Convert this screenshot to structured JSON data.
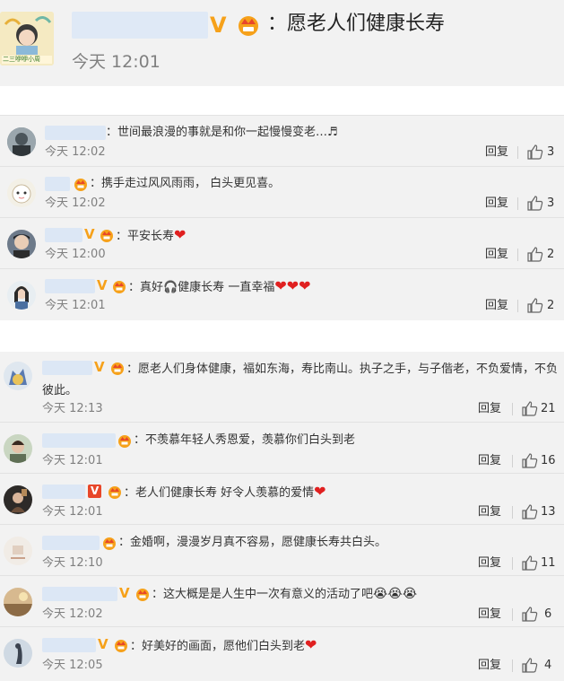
{
  "post": {
    "text": "：愿老人们健康长寿",
    "time": "今天 12:01",
    "avatar_caption": "二三咿咿小周"
  },
  "colors": {
    "vip_gold": "#f6a11a",
    "heart_red": "#e8282a",
    "panel_bg": "#f2f2f2"
  },
  "reply_label": "回复",
  "block1": [
    {
      "text": "：世间最浪漫的事就是和你一起慢慢变老…♬",
      "time": "今天 12:02",
      "likes": "3"
    },
    {
      "text": "：携手走过风风雨雨， 白头更见喜。",
      "time": "今天 12:02",
      "likes": "3"
    },
    {
      "text": "：平安长寿",
      "hearts": "❤",
      "time": "今天 12:00",
      "likes": "2"
    },
    {
      "text": "：真好🎧健康长寿  一直幸福",
      "hearts": "❤❤❤",
      "time": "今天 12:01",
      "likes": "2"
    }
  ],
  "block2": [
    {
      "text": "：愿老人们身体健康，福如东海，寿比南山。执子之手，与子偕老，不负爱情，不负彼此。",
      "time": "今天 12:13",
      "likes": "21"
    },
    {
      "text": "：不羡慕年轻人秀恩爱，羡慕你们白头到老",
      "time": "今天 12:01",
      "likes": "16"
    },
    {
      "text": "：老人们健康长寿 好令人羡慕的爱情",
      "hearts": "❤",
      "time": "今天 12:01",
      "likes": "13"
    },
    {
      "text": "：金婚啊，漫漫岁月真不容易，愿健康长寿共白头。",
      "time": "今天 12:10",
      "likes": "11"
    },
    {
      "text": "：这大概是是人生中一次有意义的活动了吧",
      "emoji": "😭😭😭",
      "time": "今天 12:02",
      "likes": "6"
    },
    {
      "text": "：好美好的画面，愿他们白头到老",
      "hearts": "❤",
      "time": "今天 12:05",
      "likes": "4"
    }
  ]
}
